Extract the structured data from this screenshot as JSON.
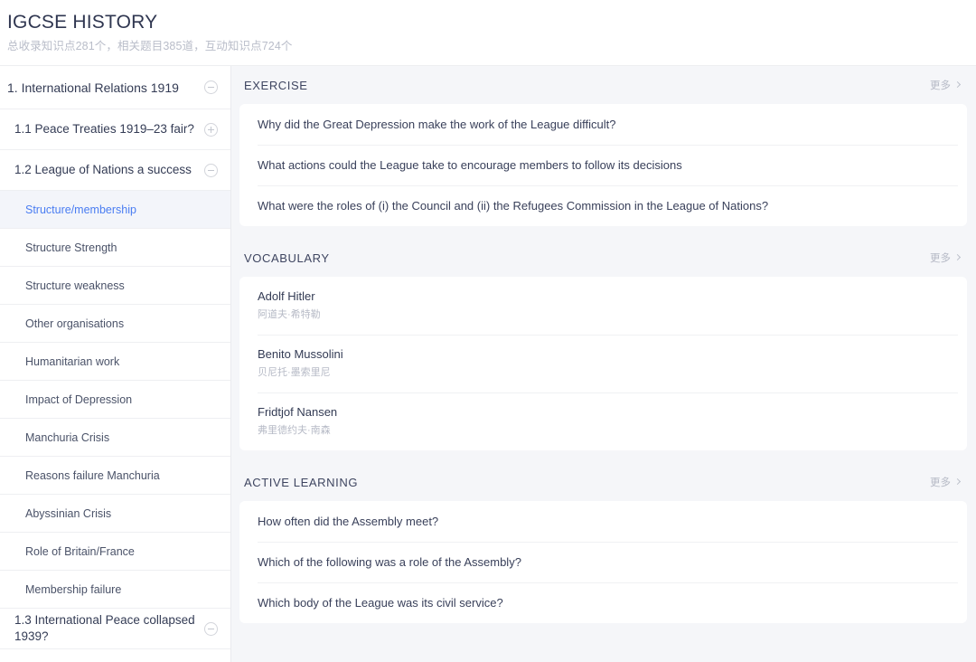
{
  "header": {
    "title": "IGCSE HISTORY",
    "subtitle": "总收录知识点281个，相关题目385道，互动知识点724个",
    "stats": {
      "knowledge_points": 281,
      "related_questions": 385,
      "interactive_points": 724
    }
  },
  "sidebar": {
    "items": [
      {
        "label": "1. International Relations 1919",
        "level": "chapter",
        "icon": "circle-minus-icon",
        "expanded": true,
        "selected": false
      },
      {
        "label": "1.1 Peace Treaties 1919–23 fair?",
        "level": "section",
        "icon": "circle-plus-icon",
        "expanded": false,
        "selected": false
      },
      {
        "label": "1.2 League of Nations a success",
        "level": "section",
        "icon": "circle-minus-icon",
        "expanded": true,
        "selected": false
      },
      {
        "label": "Structure/membership",
        "level": "topic",
        "icon": null,
        "expanded": false,
        "selected": true
      },
      {
        "label": "Structure Strength",
        "level": "topic",
        "icon": null,
        "expanded": false,
        "selected": false
      },
      {
        "label": "Structure weakness",
        "level": "topic",
        "icon": null,
        "expanded": false,
        "selected": false
      },
      {
        "label": "Other organisations",
        "level": "topic",
        "icon": null,
        "expanded": false,
        "selected": false
      },
      {
        "label": "Humanitarian work",
        "level": "topic",
        "icon": null,
        "expanded": false,
        "selected": false
      },
      {
        "label": "Impact of Depression",
        "level": "topic",
        "icon": null,
        "expanded": false,
        "selected": false
      },
      {
        "label": "Manchuria Crisis",
        "level": "topic",
        "icon": null,
        "expanded": false,
        "selected": false
      },
      {
        "label": "Reasons failure Manchuria",
        "level": "topic",
        "icon": null,
        "expanded": false,
        "selected": false
      },
      {
        "label": "Abyssinian Crisis",
        "level": "topic",
        "icon": null,
        "expanded": false,
        "selected": false
      },
      {
        "label": "Role of Britain/France",
        "level": "topic",
        "icon": null,
        "expanded": false,
        "selected": false
      },
      {
        "label": "Membership failure",
        "level": "topic",
        "icon": null,
        "expanded": false,
        "selected": false
      },
      {
        "label": "1.3 International Peace collapsed 1939?",
        "level": "section",
        "icon": "circle-minus-icon",
        "expanded": true,
        "selected": false
      }
    ]
  },
  "main": {
    "more_label": "更多",
    "sections": [
      {
        "title": "EXERCISE",
        "kind": "questions",
        "rows": [
          {
            "text": "Why did the Great Depression make the work of the League difficult?"
          },
          {
            "text": "What actions could the League take to encourage members to follow its decisions"
          },
          {
            "text": "What were the roles of (i) the Council and (ii) the Refugees Commission in the League of Nations?"
          }
        ]
      },
      {
        "title": "VOCABULARY",
        "kind": "vocabulary",
        "rows": [
          {
            "term": "Adolf Hitler",
            "translation": "阿道夫·希特勒"
          },
          {
            "term": "Benito Mussolini",
            "translation": "贝尼托·墨索里尼"
          },
          {
            "term": "Fridtjof Nansen",
            "translation": "弗里德约夫·南森"
          }
        ]
      },
      {
        "title": "ACTIVE LEARNING",
        "kind": "questions",
        "rows": [
          {
            "text": "How often did the Assembly meet?"
          },
          {
            "text": "Which of the following was a role of the Assembly?"
          },
          {
            "text": "Which body of the League was its civil service?"
          }
        ]
      }
    ]
  },
  "colors": {
    "accent": "#4a7df2",
    "text_primary": "#2f3650",
    "text_muted": "#b6bac6",
    "page_bg": "#f5f6f9",
    "card_bg": "#ffffff",
    "selected_bg": "#f3f5fa"
  }
}
